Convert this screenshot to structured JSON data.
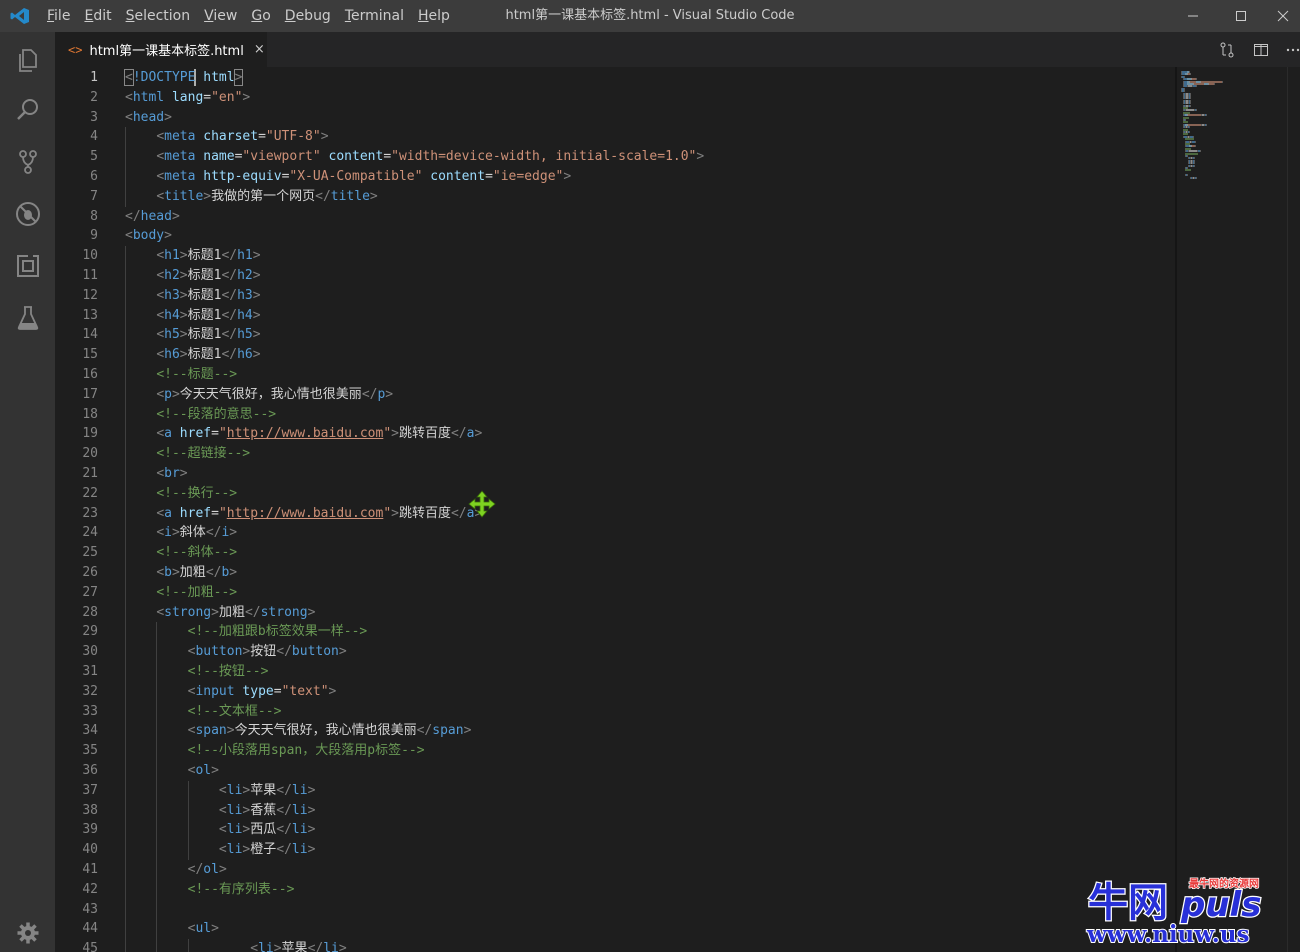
{
  "titlebar": {
    "app_logo_icon": "vscode-logo-icon",
    "menus": [
      "File",
      "Edit",
      "Selection",
      "View",
      "Go",
      "Debug",
      "Terminal",
      "Help"
    ],
    "window_title": "html第一课基本标签.html - Visual Studio Code"
  },
  "activity_bar": {
    "items": [
      "explorer-icon",
      "search-icon",
      "source-control-icon",
      "debug-icon",
      "extensions-icon",
      "test-flask-icon"
    ],
    "bottom": "settings-gear-icon"
  },
  "tab": {
    "icon_text": "<>",
    "label": "html第一课基本标签.html",
    "close": "×"
  },
  "editor": {
    "active_line": 1,
    "line_numbers": [
      "1",
      "2",
      "3",
      "4",
      "5",
      "6",
      "7",
      "8",
      "9",
      "10",
      "11",
      "12",
      "13",
      "14",
      "15",
      "16",
      "17",
      "18",
      "19",
      "20",
      "21",
      "22",
      "23",
      "24",
      "25",
      "26",
      "27",
      "28",
      "29",
      "30",
      "31",
      "32",
      "33",
      "34",
      "35",
      "36",
      "37",
      "38",
      "39",
      "40",
      "41",
      "42",
      "43",
      "44",
      "45"
    ],
    "lines": [
      [
        [
          "br",
          "<"
        ],
        [
          "tag",
          "!DOCTYPE "
        ],
        [
          "attr",
          "html"
        ],
        [
          "br",
          ">"
        ]
      ],
      [
        [
          "br",
          "<"
        ],
        [
          "tag",
          "html "
        ],
        [
          "attr",
          "lang"
        ],
        [
          "txt",
          "="
        ],
        [
          "str",
          "\"en\""
        ],
        [
          "br",
          ">"
        ]
      ],
      [
        [
          "br",
          "<"
        ],
        [
          "tag",
          "head"
        ],
        [
          "br",
          ">"
        ]
      ],
      [
        [
          "txt",
          "    "
        ],
        [
          "br",
          "<"
        ],
        [
          "tag",
          "meta "
        ],
        [
          "attr",
          "charset"
        ],
        [
          "txt",
          "="
        ],
        [
          "str",
          "\"UTF-8\""
        ],
        [
          "br",
          ">"
        ]
      ],
      [
        [
          "txt",
          "    "
        ],
        [
          "br",
          "<"
        ],
        [
          "tag",
          "meta "
        ],
        [
          "attr",
          "name"
        ],
        [
          "txt",
          "="
        ],
        [
          "str",
          "\"viewport\" "
        ],
        [
          "attr",
          "content"
        ],
        [
          "txt",
          "="
        ],
        [
          "str",
          "\"width=device-width, initial-scale=1.0\""
        ],
        [
          "br",
          ">"
        ]
      ],
      [
        [
          "txt",
          "    "
        ],
        [
          "br",
          "<"
        ],
        [
          "tag",
          "meta "
        ],
        [
          "attr",
          "http-equiv"
        ],
        [
          "txt",
          "="
        ],
        [
          "str",
          "\"X-UA-Compatible\" "
        ],
        [
          "attr",
          "content"
        ],
        [
          "txt",
          "="
        ],
        [
          "str",
          "\"ie=edge\""
        ],
        [
          "br",
          ">"
        ]
      ],
      [
        [
          "txt",
          "    "
        ],
        [
          "br",
          "<"
        ],
        [
          "tag",
          "title"
        ],
        [
          "br",
          ">"
        ],
        [
          "txt",
          "我做的第一个网页"
        ],
        [
          "br",
          "</"
        ],
        [
          "tag",
          "title"
        ],
        [
          "br",
          ">"
        ]
      ],
      [
        [
          "br",
          "</"
        ],
        [
          "tag",
          "head"
        ],
        [
          "br",
          ">"
        ]
      ],
      [
        [
          "br",
          "<"
        ],
        [
          "tag",
          "body"
        ],
        [
          "br",
          ">"
        ]
      ],
      [
        [
          "txt",
          "    "
        ],
        [
          "br",
          "<"
        ],
        [
          "tag",
          "h1"
        ],
        [
          "br",
          ">"
        ],
        [
          "txt",
          "标题1"
        ],
        [
          "br",
          "</"
        ],
        [
          "tag",
          "h1"
        ],
        [
          "br",
          ">"
        ]
      ],
      [
        [
          "txt",
          "    "
        ],
        [
          "br",
          "<"
        ],
        [
          "tag",
          "h2"
        ],
        [
          "br",
          ">"
        ],
        [
          "txt",
          "标题1"
        ],
        [
          "br",
          "</"
        ],
        [
          "tag",
          "h2"
        ],
        [
          "br",
          ">"
        ]
      ],
      [
        [
          "txt",
          "    "
        ],
        [
          "br",
          "<"
        ],
        [
          "tag",
          "h3"
        ],
        [
          "br",
          ">"
        ],
        [
          "txt",
          "标题1"
        ],
        [
          "br",
          "</"
        ],
        [
          "tag",
          "h3"
        ],
        [
          "br",
          ">"
        ]
      ],
      [
        [
          "txt",
          "    "
        ],
        [
          "br",
          "<"
        ],
        [
          "tag",
          "h4"
        ],
        [
          "br",
          ">"
        ],
        [
          "txt",
          "标题1"
        ],
        [
          "br",
          "</"
        ],
        [
          "tag",
          "h4"
        ],
        [
          "br",
          ">"
        ]
      ],
      [
        [
          "txt",
          "    "
        ],
        [
          "br",
          "<"
        ],
        [
          "tag",
          "h5"
        ],
        [
          "br",
          ">"
        ],
        [
          "txt",
          "标题1"
        ],
        [
          "br",
          "</"
        ],
        [
          "tag",
          "h5"
        ],
        [
          "br",
          ">"
        ]
      ],
      [
        [
          "txt",
          "    "
        ],
        [
          "br",
          "<"
        ],
        [
          "tag",
          "h6"
        ],
        [
          "br",
          ">"
        ],
        [
          "txt",
          "标题1"
        ],
        [
          "br",
          "</"
        ],
        [
          "tag",
          "h6"
        ],
        [
          "br",
          ">"
        ]
      ],
      [
        [
          "txt",
          "    "
        ],
        [
          "com",
          "<!--标题-->"
        ]
      ],
      [
        [
          "txt",
          "    "
        ],
        [
          "br",
          "<"
        ],
        [
          "tag",
          "p"
        ],
        [
          "br",
          ">"
        ],
        [
          "txt",
          "今天天气很好，我心情也很美丽"
        ],
        [
          "br",
          "</"
        ],
        [
          "tag",
          "p"
        ],
        [
          "br",
          ">"
        ]
      ],
      [
        [
          "txt",
          "    "
        ],
        [
          "com",
          "<!--段落的意思-->"
        ]
      ],
      [
        [
          "txt",
          "    "
        ],
        [
          "br",
          "<"
        ],
        [
          "tag",
          "a "
        ],
        [
          "attr",
          "href"
        ],
        [
          "txt",
          "="
        ],
        [
          "str",
          "\""
        ],
        [
          "link",
          "http://www.baidu.com"
        ],
        [
          "str",
          "\""
        ],
        [
          "br",
          ">"
        ],
        [
          "txt",
          "跳转百度"
        ],
        [
          "br",
          "</"
        ],
        [
          "tag",
          "a"
        ],
        [
          "br",
          ">"
        ]
      ],
      [
        [
          "txt",
          "    "
        ],
        [
          "com",
          "<!--超链接-->"
        ]
      ],
      [
        [
          "txt",
          "    "
        ],
        [
          "br",
          "<"
        ],
        [
          "tag",
          "br"
        ],
        [
          "br",
          ">"
        ]
      ],
      [
        [
          "txt",
          "    "
        ],
        [
          "com",
          "<!--换行-->"
        ]
      ],
      [
        [
          "txt",
          "    "
        ],
        [
          "br",
          "<"
        ],
        [
          "tag",
          "a "
        ],
        [
          "attr",
          "href"
        ],
        [
          "txt",
          "="
        ],
        [
          "str",
          "\""
        ],
        [
          "link",
          "http://www.baidu.com"
        ],
        [
          "str",
          "\""
        ],
        [
          "br",
          ">"
        ],
        [
          "txt",
          "跳转百度"
        ],
        [
          "br",
          "</"
        ],
        [
          "tag",
          "a"
        ],
        [
          "br",
          ">"
        ]
      ],
      [
        [
          "txt",
          "    "
        ],
        [
          "br",
          "<"
        ],
        [
          "tag",
          "i"
        ],
        [
          "br",
          ">"
        ],
        [
          "txt",
          "斜体"
        ],
        [
          "br",
          "</"
        ],
        [
          "tag",
          "i"
        ],
        [
          "br",
          ">"
        ]
      ],
      [
        [
          "txt",
          "    "
        ],
        [
          "com",
          "<!--斜体-->"
        ]
      ],
      [
        [
          "txt",
          "    "
        ],
        [
          "br",
          "<"
        ],
        [
          "tag",
          "b"
        ],
        [
          "br",
          ">"
        ],
        [
          "txt",
          "加粗"
        ],
        [
          "br",
          "</"
        ],
        [
          "tag",
          "b"
        ],
        [
          "br",
          ">"
        ]
      ],
      [
        [
          "txt",
          "    "
        ],
        [
          "com",
          "<!--加粗-->"
        ]
      ],
      [
        [
          "txt",
          "    "
        ],
        [
          "br",
          "<"
        ],
        [
          "tag",
          "strong"
        ],
        [
          "br",
          ">"
        ],
        [
          "txt",
          "加粗"
        ],
        [
          "br",
          "</"
        ],
        [
          "tag",
          "strong"
        ],
        [
          "br",
          ">"
        ]
      ],
      [
        [
          "txt",
          "        "
        ],
        [
          "com",
          "<!--加粗跟b标签效果一样-->"
        ]
      ],
      [
        [
          "txt",
          "        "
        ],
        [
          "br",
          "<"
        ],
        [
          "tag",
          "button"
        ],
        [
          "br",
          ">"
        ],
        [
          "txt",
          "按钮"
        ],
        [
          "br",
          "</"
        ],
        [
          "tag",
          "button"
        ],
        [
          "br",
          ">"
        ]
      ],
      [
        [
          "txt",
          "        "
        ],
        [
          "com",
          "<!--按钮-->"
        ]
      ],
      [
        [
          "txt",
          "        "
        ],
        [
          "br",
          "<"
        ],
        [
          "tag",
          "input "
        ],
        [
          "attr",
          "type"
        ],
        [
          "txt",
          "="
        ],
        [
          "str",
          "\"text\""
        ],
        [
          "br",
          ">"
        ]
      ],
      [
        [
          "txt",
          "        "
        ],
        [
          "com",
          "<!--文本框-->"
        ]
      ],
      [
        [
          "txt",
          "        "
        ],
        [
          "br",
          "<"
        ],
        [
          "tag",
          "span"
        ],
        [
          "br",
          ">"
        ],
        [
          "txt",
          "今天天气很好，我心情也很美丽"
        ],
        [
          "br",
          "</"
        ],
        [
          "tag",
          "span"
        ],
        [
          "br",
          ">"
        ]
      ],
      [
        [
          "txt",
          "        "
        ],
        [
          "com",
          "<!--小段落用span，大段落用p标签-->"
        ]
      ],
      [
        [
          "txt",
          "        "
        ],
        [
          "br",
          "<"
        ],
        [
          "tag",
          "ol"
        ],
        [
          "br",
          ">"
        ]
      ],
      [
        [
          "txt",
          "            "
        ],
        [
          "br",
          "<"
        ],
        [
          "tag",
          "li"
        ],
        [
          "br",
          ">"
        ],
        [
          "txt",
          "苹果"
        ],
        [
          "br",
          "</"
        ],
        [
          "tag",
          "li"
        ],
        [
          "br",
          ">"
        ]
      ],
      [
        [
          "txt",
          "            "
        ],
        [
          "br",
          "<"
        ],
        [
          "tag",
          "li"
        ],
        [
          "br",
          ">"
        ],
        [
          "txt",
          "香蕉"
        ],
        [
          "br",
          "</"
        ],
        [
          "tag",
          "li"
        ],
        [
          "br",
          ">"
        ]
      ],
      [
        [
          "txt",
          "            "
        ],
        [
          "br",
          "<"
        ],
        [
          "tag",
          "li"
        ],
        [
          "br",
          ">"
        ],
        [
          "txt",
          "西瓜"
        ],
        [
          "br",
          "</"
        ],
        [
          "tag",
          "li"
        ],
        [
          "br",
          ">"
        ]
      ],
      [
        [
          "txt",
          "            "
        ],
        [
          "br",
          "<"
        ],
        [
          "tag",
          "li"
        ],
        [
          "br",
          ">"
        ],
        [
          "txt",
          "橙子"
        ],
        [
          "br",
          "</"
        ],
        [
          "tag",
          "li"
        ],
        [
          "br",
          ">"
        ]
      ],
      [
        [
          "txt",
          "        "
        ],
        [
          "br",
          "</"
        ],
        [
          "tag",
          "ol"
        ],
        [
          "br",
          ">"
        ]
      ],
      [
        [
          "txt",
          "        "
        ],
        [
          "com",
          "<!--有序列表-->"
        ]
      ],
      [
        [
          "txt",
          ""
        ]
      ],
      [
        [
          "txt",
          "        "
        ],
        [
          "br",
          "<"
        ],
        [
          "tag",
          "ul"
        ],
        [
          "br",
          ">"
        ]
      ],
      [
        [
          "txt",
          "                "
        ],
        [
          "br",
          "<"
        ],
        [
          "tag",
          "li"
        ],
        [
          "br",
          ">"
        ],
        [
          "txt",
          "苹果"
        ],
        [
          "br",
          "</"
        ],
        [
          "tag",
          "li"
        ],
        [
          "br",
          ">"
        ]
      ]
    ]
  },
  "watermark": {
    "brand": "牛网",
    "brand_latin": "puls",
    "tagline": "最牛网的资源网",
    "url": "www.niuw.us"
  },
  "colors": {
    "tag": "#569cd6",
    "attr": "#9cdcfe",
    "string": "#ce9178",
    "comment": "#6a9955",
    "text": "#d4d4d4",
    "bracket": "#808080"
  }
}
